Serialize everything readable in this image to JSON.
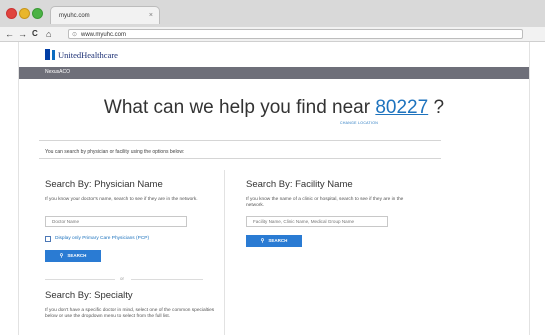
{
  "browser": {
    "tab_title": "myuhc.com",
    "url": "www.myuhc.com",
    "back_glyph": "←",
    "forward_glyph": "→",
    "reload_glyph": "C",
    "home_glyph": "⌂",
    "close_glyph": "×"
  },
  "site": {
    "logo_text": "UnitedHealthcare",
    "nav_label": "NexusACO"
  },
  "headline": {
    "prefix": "What can we help you find near ",
    "zip": "80227",
    "suffix": " ?",
    "change_location": "CHANGE LOCATION"
  },
  "intro_text": "You can search by physician or facility using the options below:",
  "physician": {
    "title": "Search By: Physician Name",
    "desc": "If you know your doctor's name, search to see if they are in the network.",
    "placeholder": "Doctor Name",
    "checkbox_label": "Display only Primary Care Physicians (PCP)",
    "search_label": "SEARCH"
  },
  "or_text": "or",
  "specialty": {
    "title": "Search By: Specialty",
    "desc": "If you don't have a specific doctor in mind, select one of the common specialties below or use the dropdown menu to select from the full list."
  },
  "facility": {
    "title": "Search By: Facility Name",
    "desc": "If you know the name of a clinic or hospital, search to see if they are in the network.",
    "placeholder": "Facility Name, Clinic Name, Medical Group Name",
    "search_label": "SEARCH"
  },
  "colors": {
    "accent": "#2a7bd3",
    "link": "#1e73be",
    "brand": "#1b2f74",
    "nav_bar": "#6e6f79"
  }
}
